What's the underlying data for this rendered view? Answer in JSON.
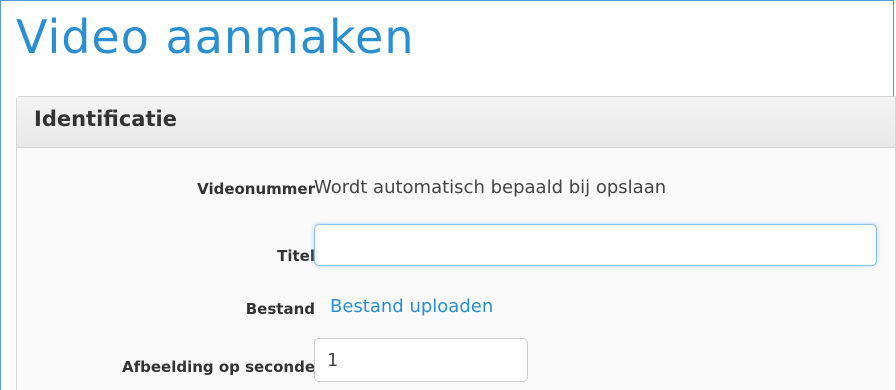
{
  "page": {
    "title": "Video aanmaken"
  },
  "panel": {
    "title": "Identificatie"
  },
  "form": {
    "videonummer": {
      "label": "Videonummer",
      "value": "Wordt automatisch bepaald bij opslaan"
    },
    "titel": {
      "label": "Titel",
      "value": ""
    },
    "bestand": {
      "label": "Bestand",
      "link_text": "Bestand uploaden"
    },
    "afbeelding": {
      "label": "Afbeelding op seconde",
      "value": "1"
    }
  },
  "colors": {
    "accent": "#2a8fd0",
    "frame_border": "#5b9bd5"
  }
}
